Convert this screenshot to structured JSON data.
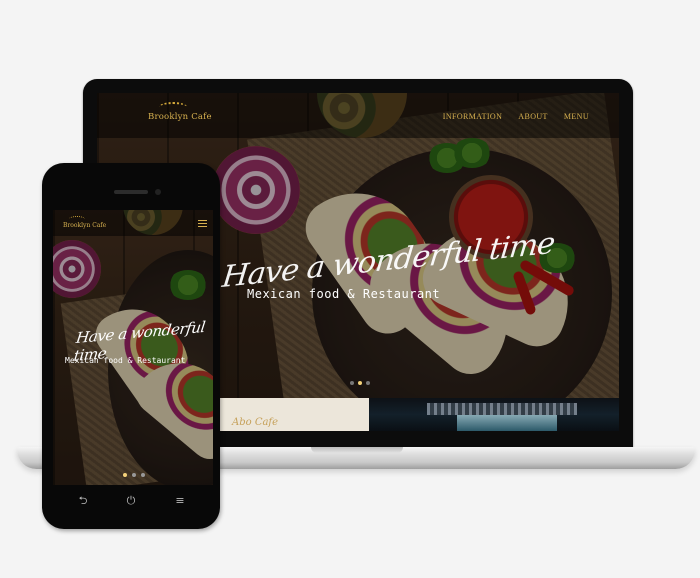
{
  "brand": "Brooklyn Cafe",
  "laptop": {
    "nav": {
      "logo": "Brooklyn Cafe",
      "items": [
        {
          "label": "INFORMATION"
        },
        {
          "label": "ABOUT"
        },
        {
          "label": "MENU"
        }
      ]
    },
    "hero": {
      "script_title": "Have a wonderful time",
      "subtitle": "Mexican food & Restaurant"
    },
    "slider": {
      "count": 3,
      "active": 1
    },
    "strip_text": "Abo Cafe"
  },
  "phone": {
    "nav": {
      "logo": "Brooklyn Cafe",
      "menu_icon": "hamburger-icon"
    },
    "hero": {
      "script_title": "Have a wonderful time",
      "subtitle": "Mexican food & Restaurant"
    },
    "slider": {
      "count": 3,
      "active": 0
    },
    "buttons": {
      "back_icon": "back-icon",
      "back_glyph": "⮌",
      "power_icon": "power-icon",
      "power_glyph": "⏻",
      "menu_icon": "menu-icon",
      "menu_glyph": "≡"
    }
  },
  "colors": {
    "gold": "#d7b150",
    "dot_active": "#f4d27a",
    "device_frame": "#0c0c0c",
    "background": "#f4f4f4"
  }
}
